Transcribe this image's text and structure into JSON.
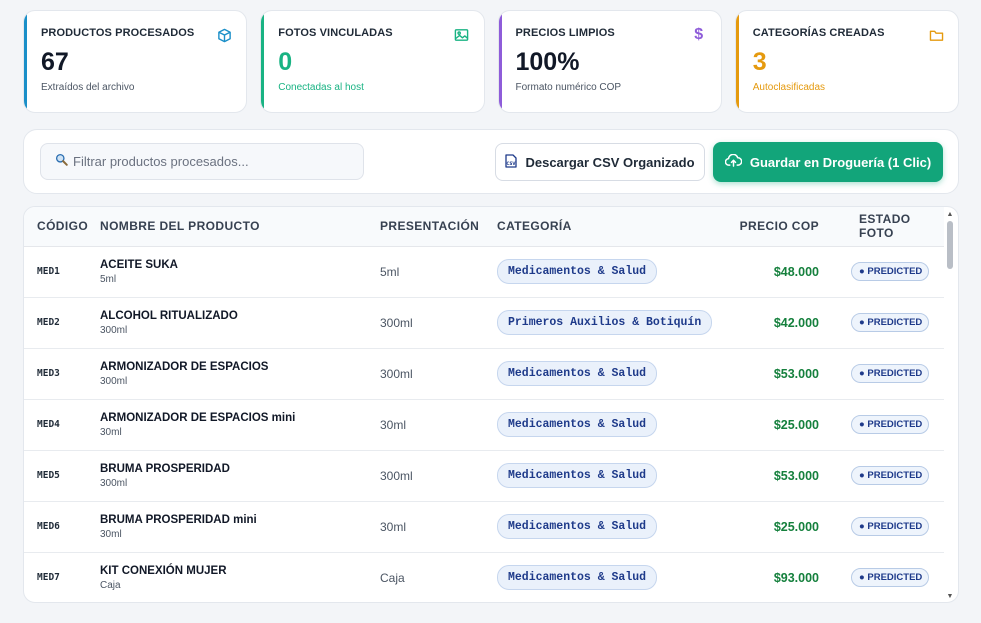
{
  "stats": [
    {
      "title": "PRODUCTOS PROCESADOS",
      "value": "67",
      "sub": "Extraídos del archivo",
      "color": "#1a8fc8",
      "value_color": "#111827",
      "sub_color": "#4b5563",
      "icon": "cube-icon"
    },
    {
      "title": "FOTOS VINCULADAS",
      "value": "0",
      "sub": "Conectadas al host",
      "color": "#19b383",
      "value_color": "#19b383",
      "sub_color": "#19b383",
      "icon": "image-icon"
    },
    {
      "title": "PRECIOS LIMPIOS",
      "value": "100%",
      "sub": "Formato numérico COP",
      "color": "#8e5cd9",
      "value_color": "#111827",
      "sub_color": "#4b5563",
      "icon": "dollar-icon"
    },
    {
      "title": "CATEGORÍAS CREADAS",
      "value": "3",
      "sub": "Autoclasificadas",
      "color": "#e59a0e",
      "value_color": "#e59a0e",
      "sub_color": "#e59a0e",
      "icon": "folder-icon"
    }
  ],
  "toolbar": {
    "search_placeholder": "Filtrar productos procesados...",
    "csv_label": "Descargar CSV Organizado",
    "save_label": "Guardar en Droguería (1 Clic)"
  },
  "table": {
    "headers": [
      "CÓDIGO",
      "NOMBRE DEL PRODUCTO",
      "PRESENTACIÓN",
      "CATEGORÍA",
      "PRECIO COP",
      "ESTADO FOTO"
    ],
    "rows": [
      {
        "code": "MED1",
        "name": "ACEITE SUKA",
        "size": "5ml",
        "presentation": "5ml",
        "category": "Medicamentos & Salud",
        "price": "$48.000",
        "status": "● PREDICTED"
      },
      {
        "code": "MED2",
        "name": "ALCOHOL RITUALIZADO",
        "size": "300ml",
        "presentation": "300ml",
        "category": "Primeros Auxilios & Botiquín",
        "price": "$42.000",
        "status": "● PREDICTED"
      },
      {
        "code": "MED3",
        "name": "ARMONIZADOR DE ESPACIOS",
        "size": "300ml",
        "presentation": "300ml",
        "category": "Medicamentos & Salud",
        "price": "$53.000",
        "status": "● PREDICTED"
      },
      {
        "code": "MED4",
        "name": "ARMONIZADOR DE ESPACIOS mini",
        "size": "30ml",
        "presentation": "30ml",
        "category": "Medicamentos & Salud",
        "price": "$25.000",
        "status": "● PREDICTED"
      },
      {
        "code": "MED5",
        "name": "BRUMA PROSPERIDAD",
        "size": "300ml",
        "presentation": "300ml",
        "category": "Medicamentos & Salud",
        "price": "$53.000",
        "status": "● PREDICTED"
      },
      {
        "code": "MED6",
        "name": "BRUMA PROSPERIDAD mini",
        "size": "30ml",
        "presentation": "30ml",
        "category": "Medicamentos & Salud",
        "price": "$25.000",
        "status": "● PREDICTED"
      },
      {
        "code": "MED7",
        "name": "KIT CONEXIÓN MUJER",
        "size": "Caja",
        "presentation": "Caja",
        "category": "Medicamentos & Salud",
        "price": "$93.000",
        "status": "● PREDICTED"
      }
    ]
  }
}
